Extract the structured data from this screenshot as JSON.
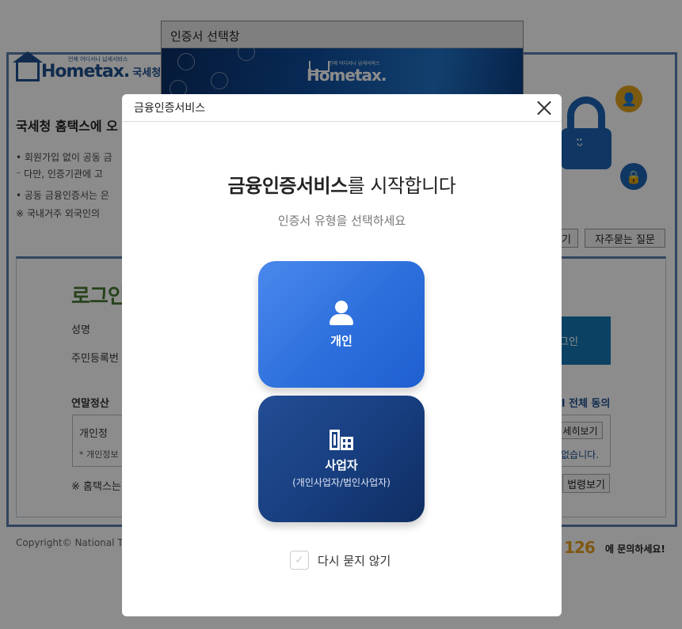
{
  "background": {
    "logo": {
      "brand": "Hometax.",
      "tagline": "언제 어디서나 납세서비스",
      "korean_name": "국세청홈택스"
    },
    "welcome_text": "국세청 홈택스에 오",
    "bullets": [
      "• 회원가입 없이 공동 금",
      "  ⁻ 다만, 인증기관에 고",
      "• 공동 금융인증서는 은",
      "  ※ 국내거주 외국인의"
    ],
    "buttons": {
      "view_label": "기",
      "faq_label": "자주묻는 질문"
    },
    "login": {
      "title": "로그인",
      "name_label": "성명",
      "rrn_label": "주민등록번",
      "login_button": "그인",
      "year_end_label": "연말정산",
      "agree_all": "l 전체 동의",
      "privacy_label": "개인정",
      "privacy_note": "* 개인정보",
      "view_detail": "세히보기",
      "possible_text": "없습니다.",
      "notice": "※ 홈택스는",
      "law_view": "법령보기"
    },
    "footer": "Copyright© National T",
    "contact": {
      "number": "126",
      "text": "에 문의하세요!"
    }
  },
  "cert_window": {
    "title": "인증서 선택창",
    "banner_brand": "Hometax.",
    "banner_tagline": "언제 어디서나 납세서비스"
  },
  "modal": {
    "header_title": "금융인증서비스",
    "title_bold": "금융인증서비스",
    "title_rest": "를 시작합니다",
    "subtitle": "인증서 유형을 선택하세요",
    "options": [
      {
        "label": "개인",
        "sublabel": ""
      },
      {
        "label": "사업자",
        "sublabel": "(개인사업자/법인사업자)"
      }
    ],
    "dont_ask_label": "다시 묻지 않기",
    "dont_ask_checked": false
  },
  "colors": {
    "personal_card": "#2c6fdc",
    "business_card": "#183f80",
    "overlay": "rgba(0,0,0,0.45)"
  }
}
